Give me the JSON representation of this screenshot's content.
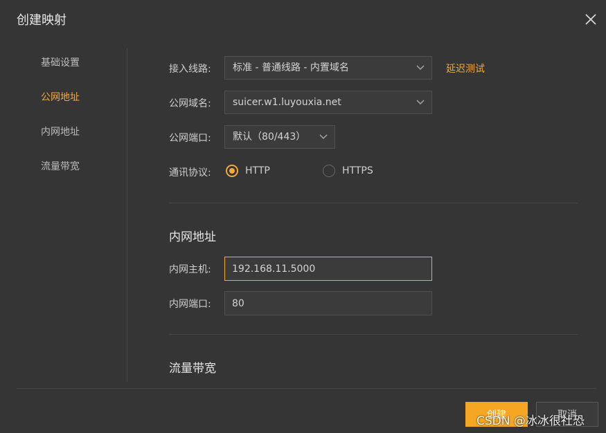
{
  "dialog": {
    "title": "创建映射",
    "close_icon": "close-icon"
  },
  "sidebar": {
    "items": [
      {
        "label": "基础设置",
        "active": false
      },
      {
        "label": "公网地址",
        "active": true
      },
      {
        "label": "内网地址",
        "active": false
      },
      {
        "label": "流量带宽",
        "active": false
      }
    ]
  },
  "public": {
    "line": {
      "label": "接入线路:",
      "value": "标准 - 普通线路 - 内置域名"
    },
    "latency_test": "延迟测试",
    "domain": {
      "label": "公网域名:",
      "value": "suicer.w1.luyouxia.net"
    },
    "port": {
      "label": "公网端口:",
      "value": "默认（80/443）"
    },
    "protocol": {
      "label": "通讯协议:",
      "options": [
        {
          "label": "HTTP",
          "checked": true
        },
        {
          "label": "HTTPS",
          "checked": false
        }
      ]
    }
  },
  "internal": {
    "section_title": "内网地址",
    "host": {
      "label": "内网主机:",
      "value": "192.168.11.5000"
    },
    "port": {
      "label": "内网端口:",
      "value": "80"
    }
  },
  "bandwidth": {
    "section_title": "流量带宽"
  },
  "footer": {
    "create": "创建",
    "cancel": "取消"
  },
  "watermark": "CSDN @冰冰很社恐",
  "colors": {
    "accent": "#f2a93b",
    "background": "#353535"
  }
}
